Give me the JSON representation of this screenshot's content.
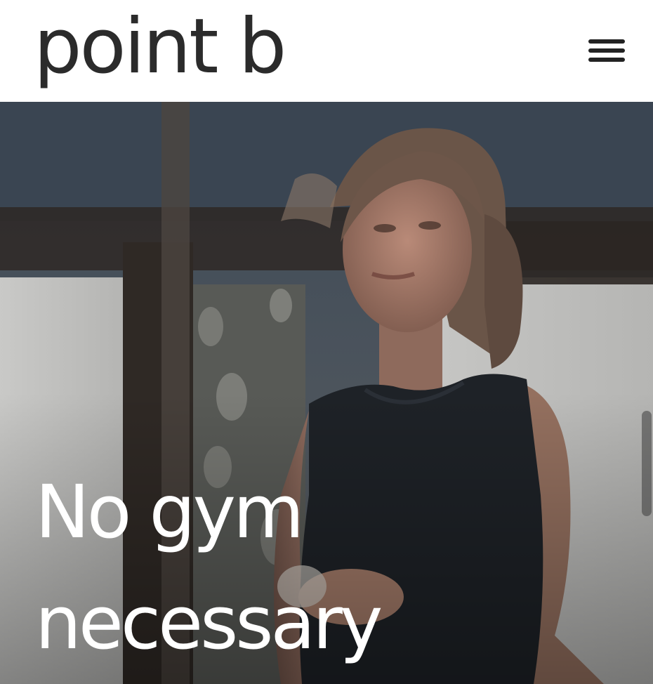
{
  "header": {
    "logo_text": "point b",
    "menu_icon": "hamburger-menu-icon"
  },
  "hero": {
    "headline_line1": "No gym",
    "headline_line2": "necessary",
    "image_description_icon": "hero-photo"
  },
  "colors": {
    "logo": "#2b2b2b",
    "menu_icon": "#222222",
    "headline": "#ffffff",
    "header_bg": "#ffffff"
  }
}
